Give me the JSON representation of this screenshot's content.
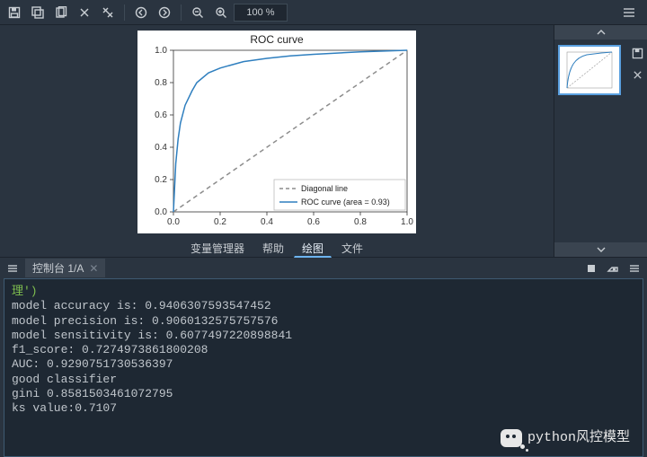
{
  "toolbar": {
    "zoom_text": "100 %"
  },
  "plot_tabs": {
    "var_manager": "变量管理器",
    "help": "帮助",
    "plot": "绘图",
    "file": "文件"
  },
  "console": {
    "tab_label": "控制台 1/A",
    "lines": [
      {
        "cls": "cl-lime",
        "text": "理')"
      },
      {
        "cls": "",
        "text": "model accuracy is: 0.9406307593547452"
      },
      {
        "cls": "",
        "text": "model precision is: 0.9060132575757576"
      },
      {
        "cls": "",
        "text": "model sensitivity is: 0.6077497220898841"
      },
      {
        "cls": "",
        "text": "f1_score: 0.7274973861800208"
      },
      {
        "cls": "",
        "text": "AUC: 0.9290751730536397"
      },
      {
        "cls": "",
        "text": "good classifier"
      },
      {
        "cls": "",
        "text": "gini 0.8581503461072795"
      },
      {
        "cls": "",
        "text": "ks value:0.7107"
      }
    ]
  },
  "watermark_text": "python风控模型",
  "chart_data": {
    "type": "line",
    "title": "ROC curve",
    "xlabel": "",
    "ylabel": "",
    "xlim": [
      0.0,
      1.0
    ],
    "ylim": [
      0.0,
      1.0
    ],
    "xticks": [
      0.0,
      0.2,
      0.4,
      0.6,
      0.8,
      1.0
    ],
    "yticks": [
      0.0,
      0.2,
      0.4,
      0.6,
      0.8,
      1.0
    ],
    "series": [
      {
        "name": "Diagonal line",
        "style": "dashed",
        "color": "#8c8c8c",
        "x": [
          0.0,
          1.0
        ],
        "y": [
          0.0,
          1.0
        ]
      },
      {
        "name": "ROC curve (area = 0.93)",
        "style": "solid",
        "color": "#2f7fbf",
        "x": [
          0.0,
          0.01,
          0.02,
          0.03,
          0.05,
          0.08,
          0.1,
          0.15,
          0.2,
          0.3,
          0.4,
          0.5,
          0.6,
          0.7,
          0.8,
          0.9,
          1.0
        ],
        "y": [
          0.0,
          0.3,
          0.45,
          0.55,
          0.66,
          0.75,
          0.8,
          0.86,
          0.89,
          0.93,
          0.95,
          0.965,
          0.975,
          0.983,
          0.99,
          0.995,
          1.0
        ]
      }
    ],
    "legend_position": "lower right"
  }
}
